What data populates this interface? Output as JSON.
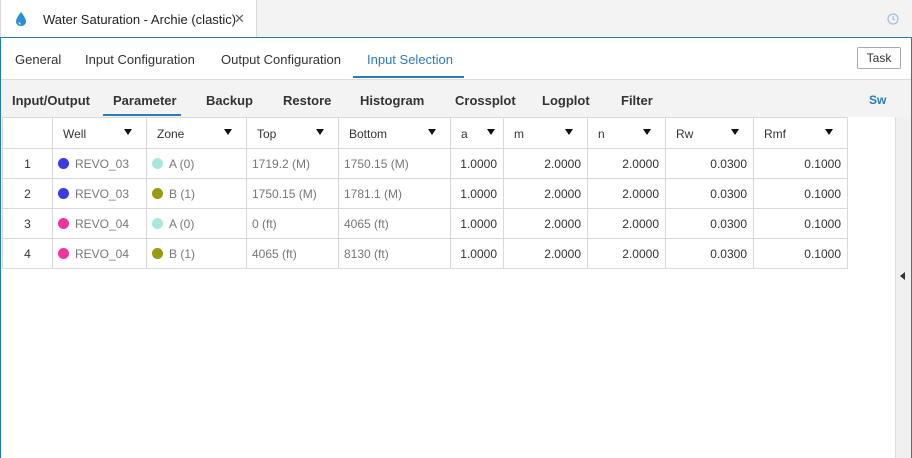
{
  "window": {
    "doc_tab_title": "Water Saturation - Archie (clastic)"
  },
  "tabs": {
    "items": [
      {
        "label": "General"
      },
      {
        "label": "Input Configuration"
      },
      {
        "label": "Output Configuration"
      },
      {
        "label": "Input Selection"
      }
    ],
    "active": "Input Selection",
    "task_button": "Task"
  },
  "subtabs": {
    "items": [
      {
        "label": "Input/Output"
      },
      {
        "label": "Parameter"
      },
      {
        "label": "Backup"
      },
      {
        "label": "Restore"
      },
      {
        "label": "Histogram"
      },
      {
        "label": "Crossplot"
      },
      {
        "label": "Logplot"
      },
      {
        "label": "Filter"
      }
    ],
    "active": "Parameter",
    "right_link": "Sw"
  },
  "table": {
    "columns": [
      "",
      "Well",
      "Zone",
      "Top",
      "Bottom",
      "a",
      "m",
      "n",
      "Rw",
      "Rmf"
    ],
    "rows": [
      {
        "idx": "1",
        "well": "REVO_03",
        "well_color": "#3a3ae6",
        "zone": "A (0)",
        "zone_color": "#a8e8dc",
        "top": "1719.2 (M)",
        "bottom": "1750.15 (M)",
        "a": "1.0000",
        "m": "2.0000",
        "n": "2.0000",
        "rw": "0.0300",
        "rmf": "0.1000"
      },
      {
        "idx": "2",
        "well": "REVO_03",
        "well_color": "#3a3ae6",
        "zone": "B (1)",
        "zone_color": "#9a9a12",
        "top": "1750.15 (M)",
        "bottom": "1781.1 (M)",
        "a": "1.0000",
        "m": "2.0000",
        "n": "2.0000",
        "rw": "0.0300",
        "rmf": "0.1000"
      },
      {
        "idx": "3",
        "well": "REVO_04",
        "well_color": "#f0359a",
        "zone": "A (0)",
        "zone_color": "#a8e8dc",
        "top": "0 (ft)",
        "bottom": "4065 (ft)",
        "a": "1.0000",
        "m": "2.0000",
        "n": "2.0000",
        "rw": "0.0300",
        "rmf": "0.1000"
      },
      {
        "idx": "4",
        "well": "REVO_04",
        "well_color": "#f0359a",
        "zone": "B (1)",
        "zone_color": "#9a9a12",
        "top": "4065 (ft)",
        "bottom": "8130 (ft)",
        "a": "1.0000",
        "m": "2.0000",
        "n": "2.0000",
        "rw": "0.0300",
        "rmf": "0.1000"
      }
    ]
  },
  "colors": {
    "accent": "#2b7bbd",
    "border": "#1f7dbf"
  }
}
